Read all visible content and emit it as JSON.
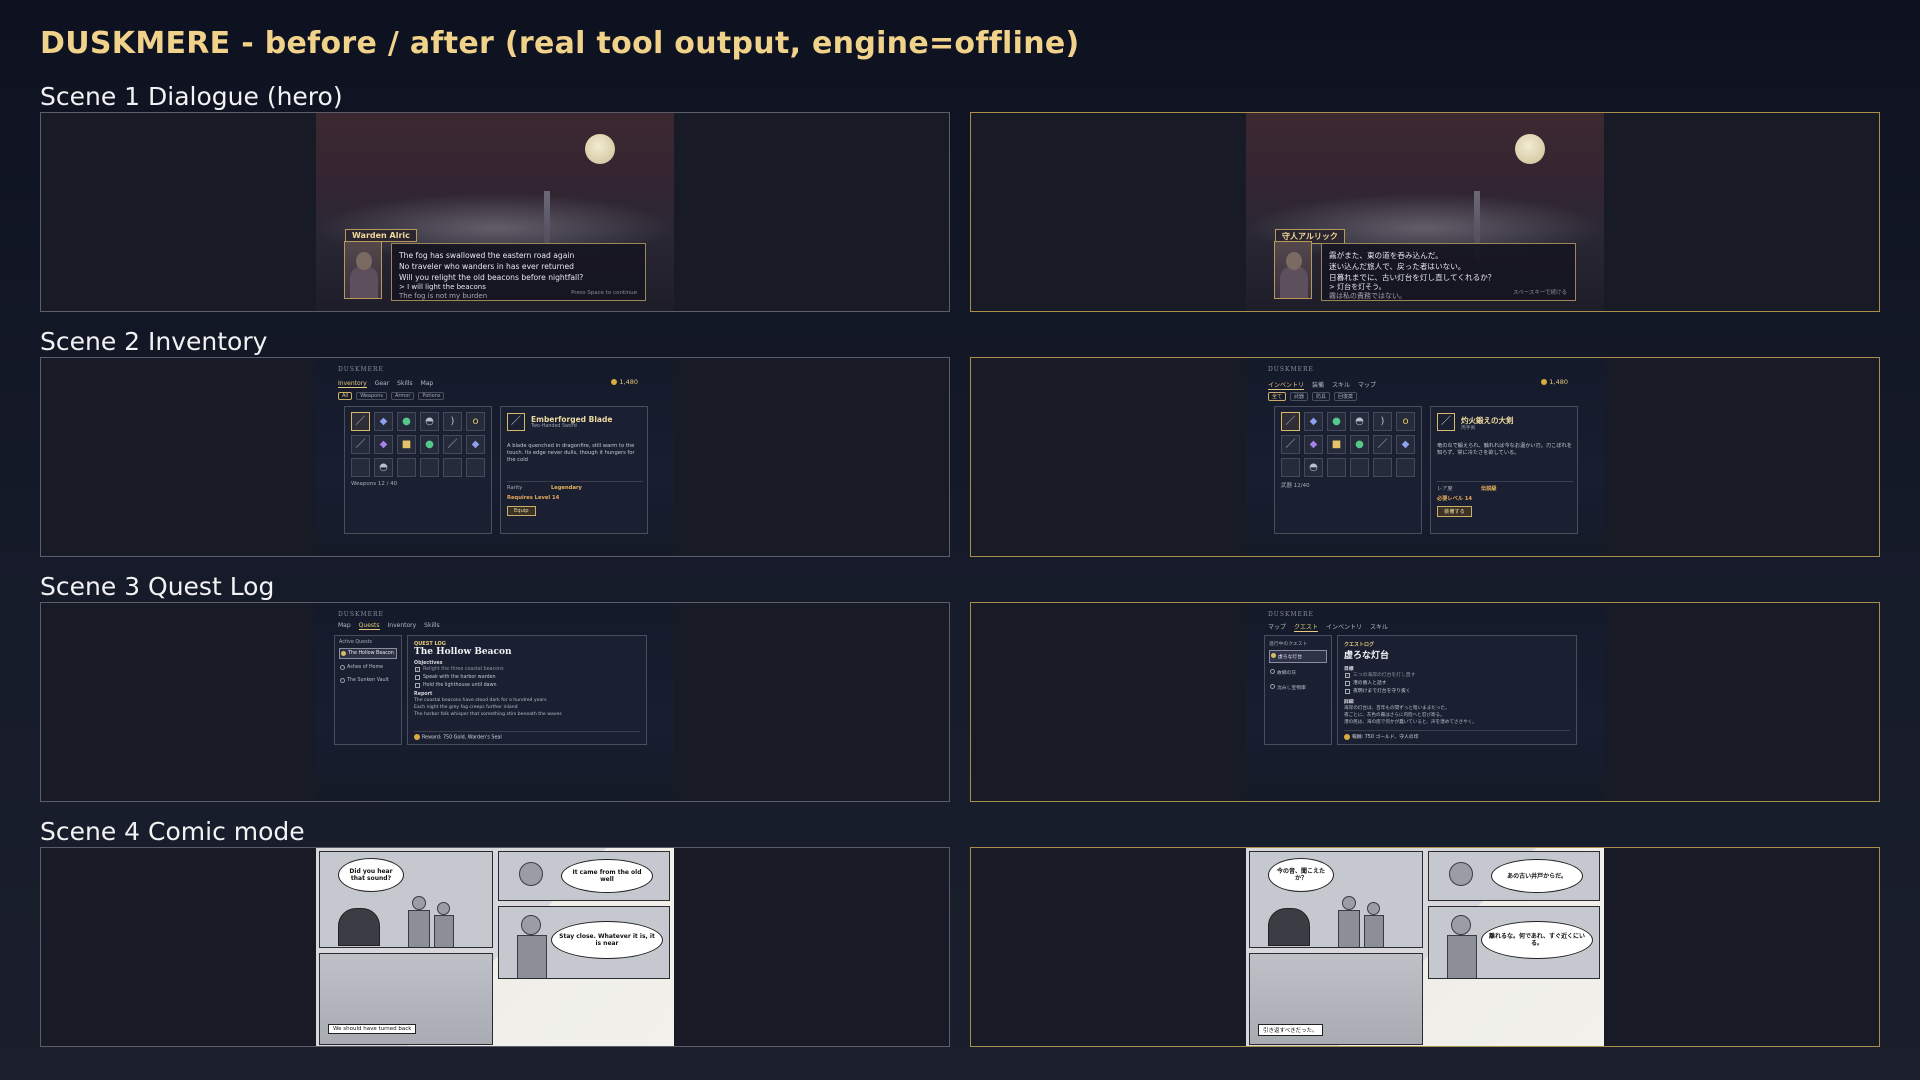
{
  "page": {
    "title": "DUSKMERE  -  before / after  (real tool output, engine=offline)"
  },
  "scenes": [
    {
      "label": "Scene 1  Dialogue (hero)"
    },
    {
      "label": "Scene 2  Inventory"
    },
    {
      "label": "Scene 3  Quest Log"
    },
    {
      "label": "Scene 4  Comic mode"
    }
  ],
  "dialogue": {
    "before": {
      "speaker": "Warden Alric",
      "lines": [
        "The fog has swallowed the eastern road again",
        "No traveler who wanders in has ever returned",
        "Will you relight the old beacons before nightfall?"
      ],
      "choices": [
        "> I will light the beacons",
        "The fog is not my burden"
      ],
      "hint": "Press Space to continue"
    },
    "after": {
      "speaker": "守人アルリック",
      "lines": [
        "霧がまた、東の道を呑み込んだ。",
        "迷い込んだ旅人で、戻った者はいない。",
        "日暮れまでに、古い灯台を灯し直してくれるか？"
      ],
      "choices": [
        "> 灯台を灯そう。",
        "霧は私の責務ではない。"
      ],
      "hint": "スペースキーで続ける"
    }
  },
  "inventory": {
    "before": {
      "brand": "DUSKMERE",
      "tabs": [
        "Inventory",
        "Gear",
        "Skills",
        "Map"
      ],
      "filters": [
        "All",
        "Weapons",
        "Armor",
        "Potions"
      ],
      "gold": "1,480",
      "count": "Weapons  12 / 40",
      "item_name": "Emberforged Blade",
      "item_type": "Two-Handed Sword",
      "item_desc": "A blade quenched in dragonfire, still warm to the touch. Its edge never dulls, though it hungers for the cold",
      "rarity_label": "Rarity",
      "rarity_value": "Legendary",
      "requirement": "Requires Level 14",
      "equip": "Equip"
    },
    "after": {
      "brand": "DUSKMERE",
      "tabs": [
        "インベントリ",
        "装備",
        "スキル",
        "マップ"
      ],
      "filters": [
        "全て",
        "武器",
        "防具",
        "回復薬"
      ],
      "gold": "1,480",
      "count": "武器  12/40",
      "item_name": "灼火鍛えの大剣",
      "item_type": "両手剣",
      "item_desc": "竜の炎で鍛えられ、触れれば今なお温かい刃。刃こぼれを知らず、常に冷たさを欲している。",
      "rarity_label": "レア度",
      "rarity_value": "伝説級",
      "requirement": "必要レベル 14",
      "equip": "装備する"
    },
    "slots": [
      {
        "icon": "sword-icon",
        "glyph": "／",
        "tone": "sel"
      },
      {
        "icon": "gem-icon",
        "glyph": "◆",
        "tone": "blue"
      },
      {
        "icon": "potion-icon",
        "glyph": "●",
        "tone": "green"
      },
      {
        "icon": "helmet-icon",
        "glyph": "◓",
        "tone": "plain"
      },
      {
        "icon": "bow-icon",
        "glyph": ")",
        "tone": "plain"
      },
      {
        "icon": "ring-icon",
        "glyph": "o",
        "tone": "gold"
      },
      {
        "icon": "wand-icon",
        "glyph": "／",
        "tone": "plain"
      },
      {
        "icon": "crystal-icon",
        "glyph": "◆",
        "tone": "purple"
      },
      {
        "icon": "scroll-icon",
        "glyph": "■",
        "tone": "gold"
      },
      {
        "icon": "potion-icon",
        "glyph": "●",
        "tone": "green"
      },
      {
        "icon": "dagger-icon",
        "glyph": "／",
        "tone": "plain"
      },
      {
        "icon": "gem-icon",
        "glyph": "◆",
        "tone": "blue"
      },
      {
        "icon": "empty-slot",
        "glyph": "",
        "tone": "empty"
      },
      {
        "icon": "helmet-icon",
        "glyph": "◓",
        "tone": "plain"
      },
      {
        "icon": "empty-slot",
        "glyph": "",
        "tone": "empty"
      },
      {
        "icon": "empty-slot",
        "glyph": "",
        "tone": "empty"
      },
      {
        "icon": "empty-slot",
        "glyph": "",
        "tone": "empty"
      },
      {
        "icon": "empty-slot",
        "glyph": "",
        "tone": "empty"
      }
    ]
  },
  "quest": {
    "before": {
      "brand": "DUSKMERE",
      "tabs": [
        "Map",
        "Quests",
        "Inventory",
        "Skills"
      ],
      "list_header": "Active Quests",
      "quests": [
        "The Hollow Beacon",
        "Ashes of Home",
        "The Sunken Vault"
      ],
      "label": "QUEST LOG",
      "title": "The Hollow Beacon",
      "objectives_header": "Objectives",
      "objectives": [
        "Relight the three coastal beacons",
        "Speak with the harbor warden",
        "Hold the lighthouse until dawn"
      ],
      "report_header": "Report",
      "report": [
        "The coastal beacons have stood dark for a hundred years",
        "Each night the grey fog creeps further inland",
        "The harbor folk whisper that something stirs beneath the waves"
      ],
      "reward": "Reward: 750 Gold, Warden's Seal"
    },
    "after": {
      "brand": "DUSKMERE",
      "tabs": [
        "マップ",
        "クエスト",
        "インベントリ",
        "スキル"
      ],
      "list_header": "進行中のクエスト",
      "quests": [
        "虚ろな灯台",
        "故郷の灰",
        "沈みし宝物庫"
      ],
      "label": "クエストログ",
      "title": "虚ろな灯台",
      "objectives_header": "目標",
      "objectives": [
        "三つの海岸の灯台を灯し直す",
        "港の番人と話す",
        "夜明けまで灯台を守り抜く"
      ],
      "report_header": "詳細",
      "report": [
        "海岸の灯台は、百年もの間ずっと暗いままだった。",
        "夜ごとに、灰色の霧はさらに内陸へと忍び寄る。",
        "港の民は、海の底で何かが蠢いていると、声を潜めてささやく。"
      ],
      "reward": "報酬: 750 ゴールド、守人の印"
    }
  },
  "comic": {
    "before": {
      "bubble1": "Did you hear that sound?",
      "bubble2": "It came from the old well",
      "bubble3": "Stay close. Whatever it is, it is near",
      "caption": "We should have turned back"
    },
    "after": {
      "bubble1": "今の音、聞こえたか？",
      "bubble2": "あの古い井戸からだ。",
      "bubble3": "離れるな。何であれ、すぐ近くにいる。",
      "caption": "引き返すべきだった。"
    }
  }
}
